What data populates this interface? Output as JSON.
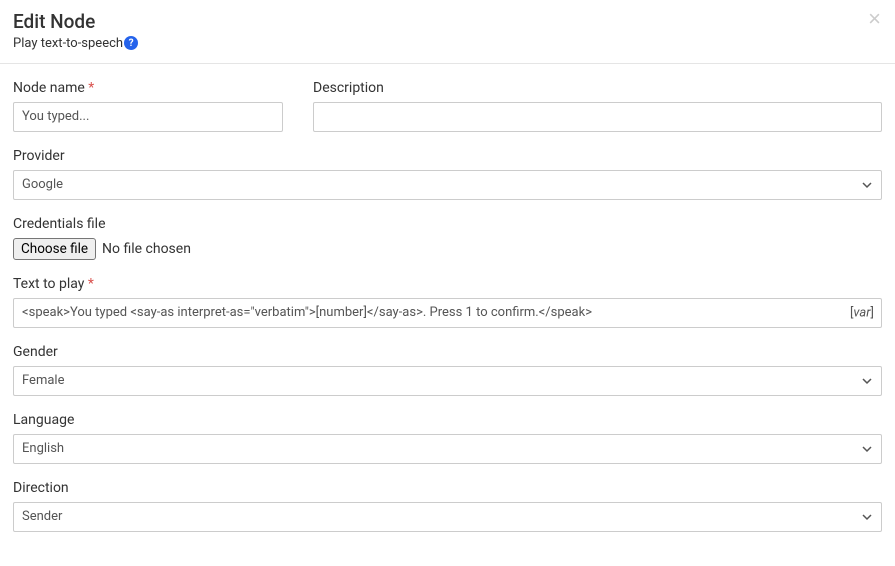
{
  "header": {
    "title": "Edit Node",
    "subtitle": "Play text-to-speech",
    "help_icon_label": "?",
    "close_label": "×"
  },
  "form": {
    "node_name": {
      "label": "Node name",
      "required_mark": "*",
      "value": "You typed..."
    },
    "description": {
      "label": "Description",
      "value": ""
    },
    "provider": {
      "label": "Provider",
      "value": "Google"
    },
    "credentials": {
      "label": "Credentials file",
      "button": "Choose file",
      "status": "No file chosen"
    },
    "text_to_play": {
      "label": "Text to play",
      "required_mark": "*",
      "value": "<speak>You typed <say-as interpret-as=\"verbatim\">[number]</say-as>. Press 1 to confirm.</speak>",
      "var_badge": "var"
    },
    "gender": {
      "label": "Gender",
      "value": "Female"
    },
    "language": {
      "label": "Language",
      "value": "English"
    },
    "direction": {
      "label": "Direction",
      "value": "Sender"
    }
  }
}
